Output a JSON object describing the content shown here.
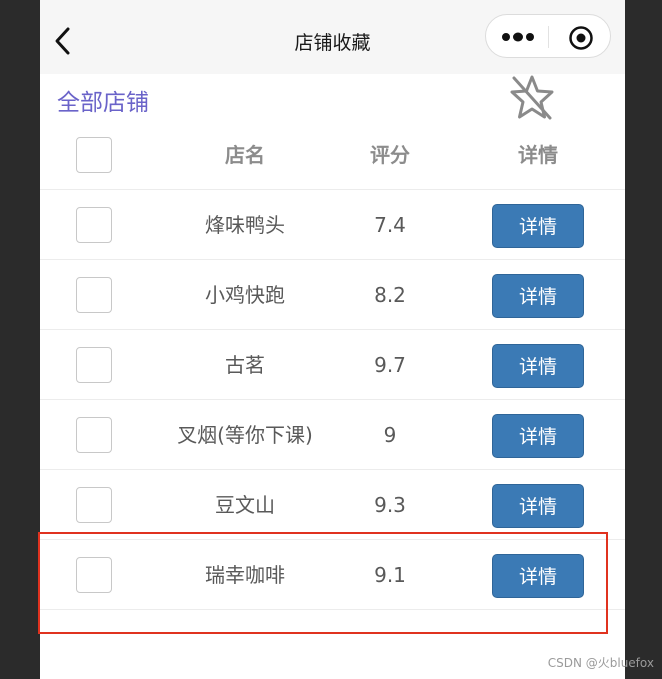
{
  "navbar": {
    "title": "店铺收藏"
  },
  "section": {
    "label": "全部店铺"
  },
  "table": {
    "headers": {
      "name": "店名",
      "score": "评分",
      "detail": "详情"
    },
    "rows": [
      {
        "name": "烽味鸭头",
        "score": "7.4",
        "button": "详情"
      },
      {
        "name": "小鸡快跑",
        "score": "8.2",
        "button": "详情"
      },
      {
        "name": "古茗",
        "score": "9.7",
        "button": "详情"
      },
      {
        "name": "叉烟(等你下课)",
        "score": "9",
        "button": "详情"
      },
      {
        "name": "豆文山",
        "score": "9.3",
        "button": "详情"
      },
      {
        "name": "瑞幸咖啡",
        "score": "9.1",
        "button": "详情"
      }
    ]
  },
  "icons": {
    "back": "back-arrow-icon",
    "more": "more-dots-icon",
    "close_target": "target-icon",
    "star": "star-off-icon"
  },
  "colors": {
    "section_label": "#6a63c9",
    "button": "#3b7ab5",
    "highlight": "#e0321f"
  },
  "watermark": "CSDN @火bluefox"
}
